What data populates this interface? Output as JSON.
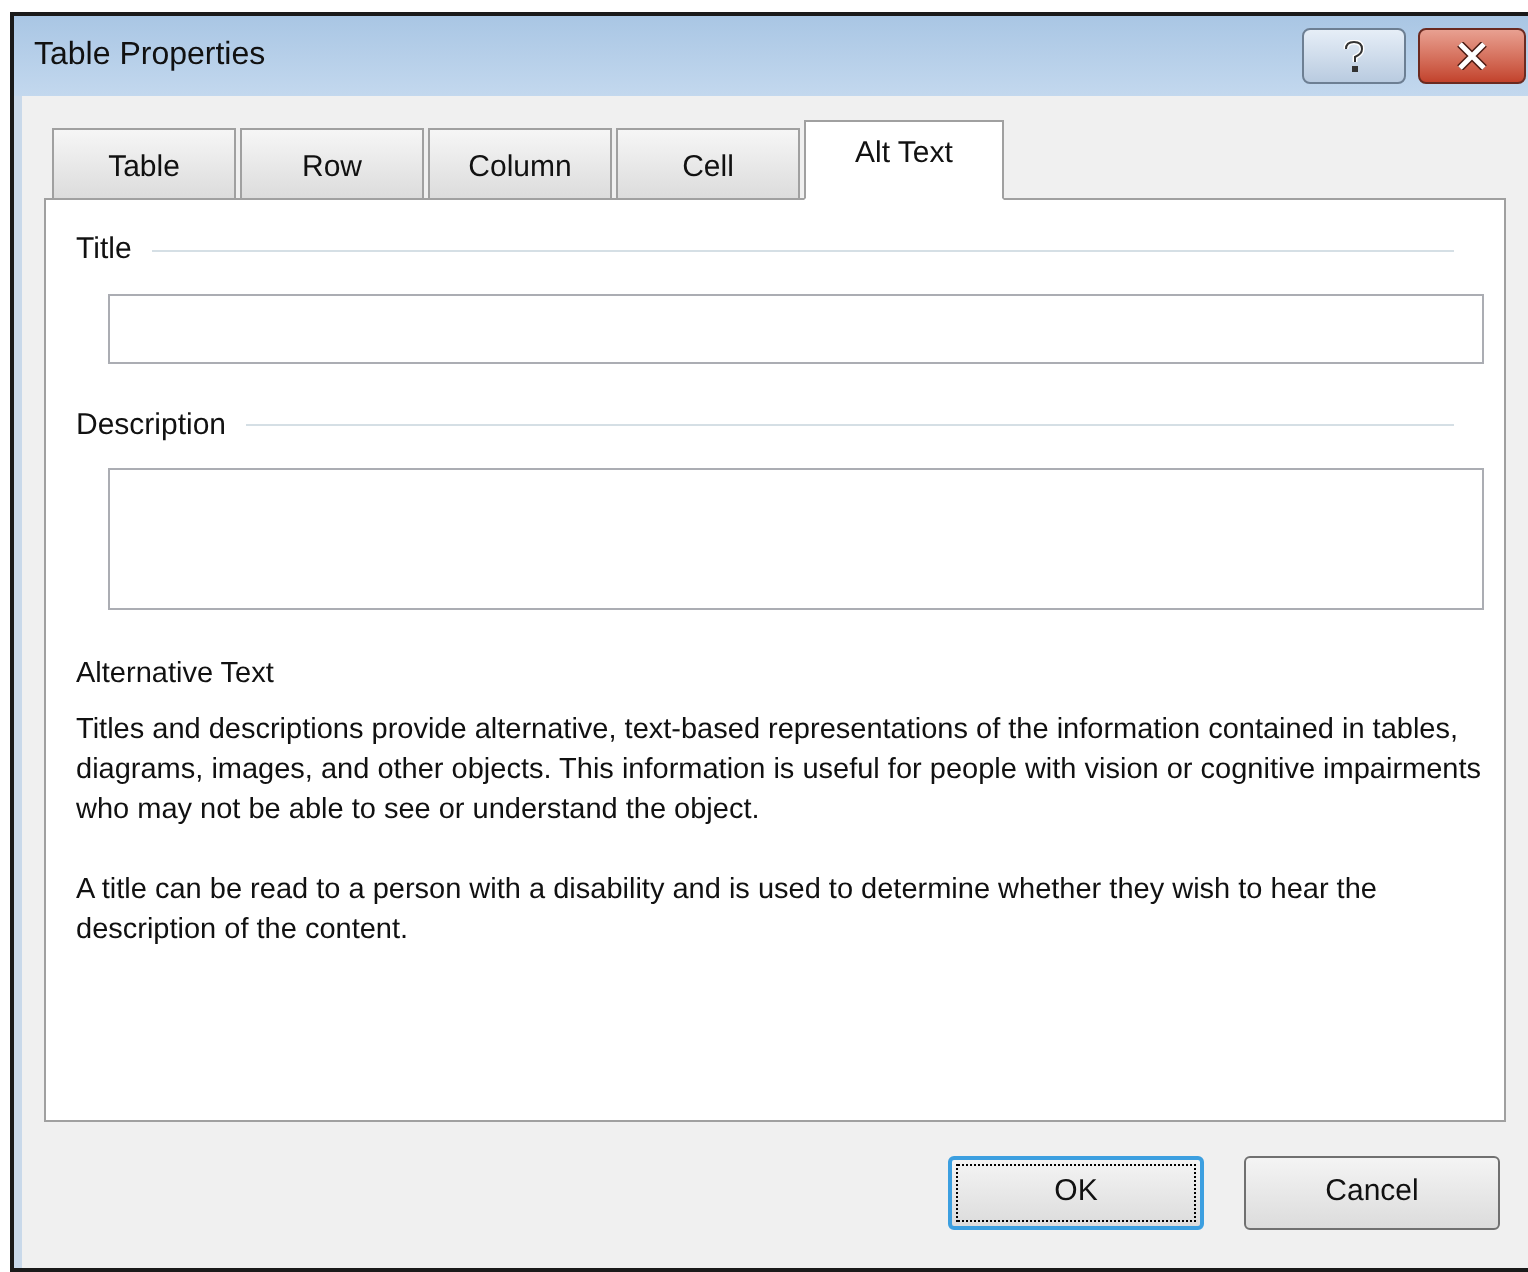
{
  "window": {
    "title": "Table Properties"
  },
  "tabs": [
    {
      "label": "Table",
      "selected": false
    },
    {
      "label": "Row",
      "selected": false
    },
    {
      "label": "Column",
      "selected": false
    },
    {
      "label": "Cell",
      "selected": false
    },
    {
      "label": "Alt Text",
      "selected": true
    }
  ],
  "fields": [
    {
      "label": "Title",
      "kind": "line"
    },
    {
      "label": "Description",
      "kind": "area"
    }
  ],
  "info": {
    "heading": "Alternative Text",
    "paragraphs": [
      "Titles and descriptions provide alternative, text-based representations of the information contained in tables, diagrams, images, and other objects. This information is useful for people with vision or cognitive impairments who may not be able to see or understand the object.",
      "A title can be read to a person with a disability and is used to determine whether they wish to hear the description of the content."
    ]
  },
  "buttons": [
    {
      "label": "OK",
      "default": true
    },
    {
      "label": "Cancel",
      "default": false
    }
  ]
}
